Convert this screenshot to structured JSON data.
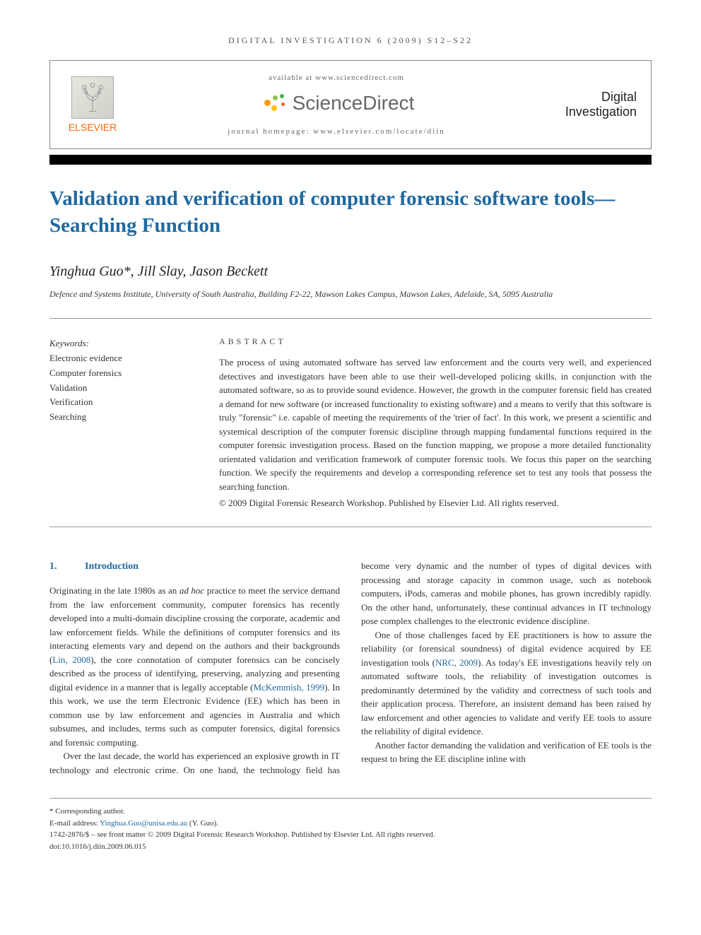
{
  "header": {
    "running_head": "DIGITAL INVESTIGATION 6 (2009) S12–S22",
    "available_at": "available at www.sciencedirect.com",
    "sciencedirect": "ScienceDirect",
    "homepage": "journal homepage: www.elsevier.com/locate/diin",
    "publisher": "ELSEVIER",
    "journal_line1": "Digital",
    "journal_line2": "Investigation"
  },
  "article": {
    "title": "Validation and verification of computer forensic software tools—Searching Function",
    "authors": "Yinghua Guo*, Jill Slay, Jason Beckett",
    "affiliation": "Defence and Systems Institute, University of South Australia, Building F2-22, Mawson Lakes Campus, Mawson Lakes, Adelaide, SA, 5095 Australia"
  },
  "abstract": {
    "heading": "ABSTRACT",
    "keywords_heading": "Keywords:",
    "keywords": [
      "Electronic evidence",
      "Computer forensics",
      "Validation",
      "Verification",
      "Searching"
    ],
    "text": "The process of using automated software has served law enforcement and the courts very well, and experienced detectives and investigators have been able to use their well-developed policing skills, in conjunction with the automated software, so as to provide sound evidence. However, the growth in the computer forensic field has created a demand for new software (or increased functionality to existing software) and a means to verify that this software is truly \"forensic\" i.e. capable of meeting the requirements of the 'trier of fact'. In this work, we present a scientific and systemical description of the computer forensic discipline through mapping fundamental functions required in the computer forensic investigation process. Based on the function mapping, we propose a more detailed functionality orientated validation and verification framework of computer forensic tools. We focus this paper on the searching function. We specify the requirements and develop a corresponding reference set to test any tools that possess the searching function.",
    "copyright": "© 2009 Digital Forensic Research Workshop. Published by Elsevier Ltd. All rights reserved."
  },
  "body": {
    "section_num": "1.",
    "section_title": "Introduction",
    "para1_a": "Originating in the late 1980s as an ",
    "para1_adhoc": "ad hoc",
    "para1_b": " practice to meet the service demand from the law enforcement community, computer forensics has recently developed into a multi-domain discipline crossing the corporate, academic and law enforcement fields. While the definitions of computer forensics and its interacting elements vary and depend on the authors and their backgrounds (",
    "cite1": "Lin, 2008",
    "para1_c": "), the core connotation of computer forensics can be concisely described as the process of identifying, preserving, analyzing and presenting digital evidence in a manner that is legally acceptable (",
    "cite2": "McKemmish, 1999",
    "para1_d": "). In this work, we use the term Electronic Evidence (EE) which has been in common use by law enforcement and agencies in Australia and which subsumes, and includes, terms such as computer forensics, digital forensics and forensic computing.",
    "para2": "Over the last decade, the world has experienced an explosive growth in IT technology and electronic crime. On one hand, the technology field has become very dynamic and the number of types of digital devices with processing and storage capacity in common usage, such as notebook computers, iPods, cameras and mobile phones, has grown incredibly rapidly. On the other hand, unfortunately, these continual advances in IT technology pose complex challenges to the electronic evidence discipline.",
    "para3_a": "One of those challenges faced by EE practitioners is how to assure the reliability (or forensical soundness) of digital evidence acquired by EE investigation tools (",
    "cite3": "NRC, 2009",
    "para3_b": "). As today's EE investigations heavily rely on automated software tools, the reliability of investigation outcomes is predominantly determined by the validity and correctness of such tools and their application process. Therefore, an insistent demand has been raised by law enforcement and other agencies to validate and verify EE tools to assure the reliability of digital evidence.",
    "para4": "Another factor demanding the validation and verification of EE tools is the request to bring the EE discipline inline with"
  },
  "footer": {
    "corresponding": "* Corresponding author.",
    "email_label": "E-mail address: ",
    "email": "Yinghua.Guo@unisa.edu.au",
    "email_suffix": " (Y. Guo).",
    "issn_line": "1742-2876/$ – see front matter © 2009 Digital Forensic Research Workshop. Published by Elsevier Ltd. All rights reserved.",
    "doi": "doi:10.1016/j.diin.2009.06.015"
  }
}
